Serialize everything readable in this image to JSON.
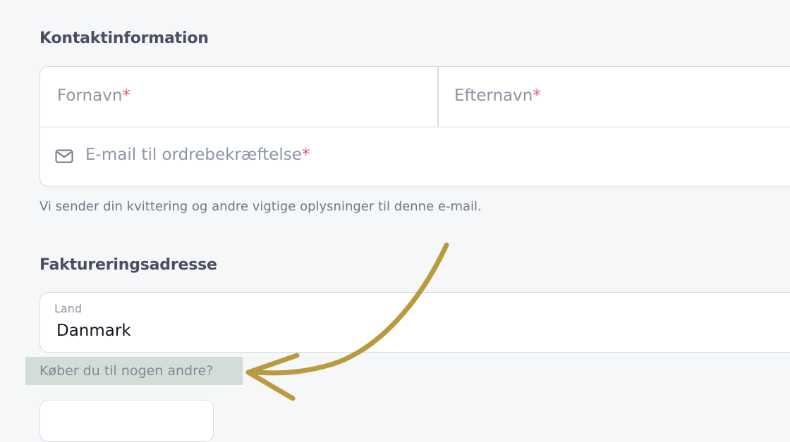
{
  "contact": {
    "title": "Kontaktinformation",
    "first_name_placeholder": "Fornavn",
    "last_name_placeholder": "Efternavn",
    "email_placeholder": "E-mail til ordrebekræftelse",
    "required_marker": "*",
    "hint": "Vi sender din kvittering og andre vigtige oplysninger til denne e-mail."
  },
  "billing": {
    "title": "Faktureringsadresse",
    "country_label": "Land",
    "country_value": "Danmark",
    "buying_for_other_link": "Køber du til nogen andre?"
  },
  "icons": {
    "email": "envelope-icon",
    "annotation": "curved-arrow-icon"
  },
  "colors": {
    "required": "#e05a6a",
    "annotation_arrow": "#b99a3e",
    "link_highlight": "#d3ddd7"
  }
}
